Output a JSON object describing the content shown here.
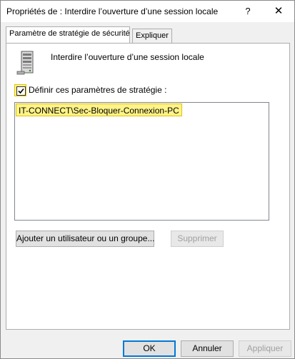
{
  "window": {
    "title": "Propriétés de : Interdire l’ouverture d’une session locale",
    "help_label": "?",
    "close_label": "✕"
  },
  "tabs": [
    {
      "label": "Paramètre de stratégie de sécurité",
      "active": true
    },
    {
      "label": "Expliquer",
      "active": false
    }
  ],
  "policy": {
    "icon": "server-icon",
    "name": "Interdire l’ouverture d’une session locale"
  },
  "define_checkbox": {
    "label": "Définir ces paramètres de stratégie :",
    "checked": true
  },
  "members": {
    "items": [
      "IT-CONNECT\\Sec-Bloquer-Connexion-PC"
    ]
  },
  "buttons": {
    "add": "Ajouter un utilisateur ou un groupe...",
    "remove": "Supprimer",
    "ok": "OK",
    "cancel": "Annuler",
    "apply": "Appliquer"
  },
  "colors": {
    "highlight": "#fff38a",
    "accent": "#0078d7"
  }
}
